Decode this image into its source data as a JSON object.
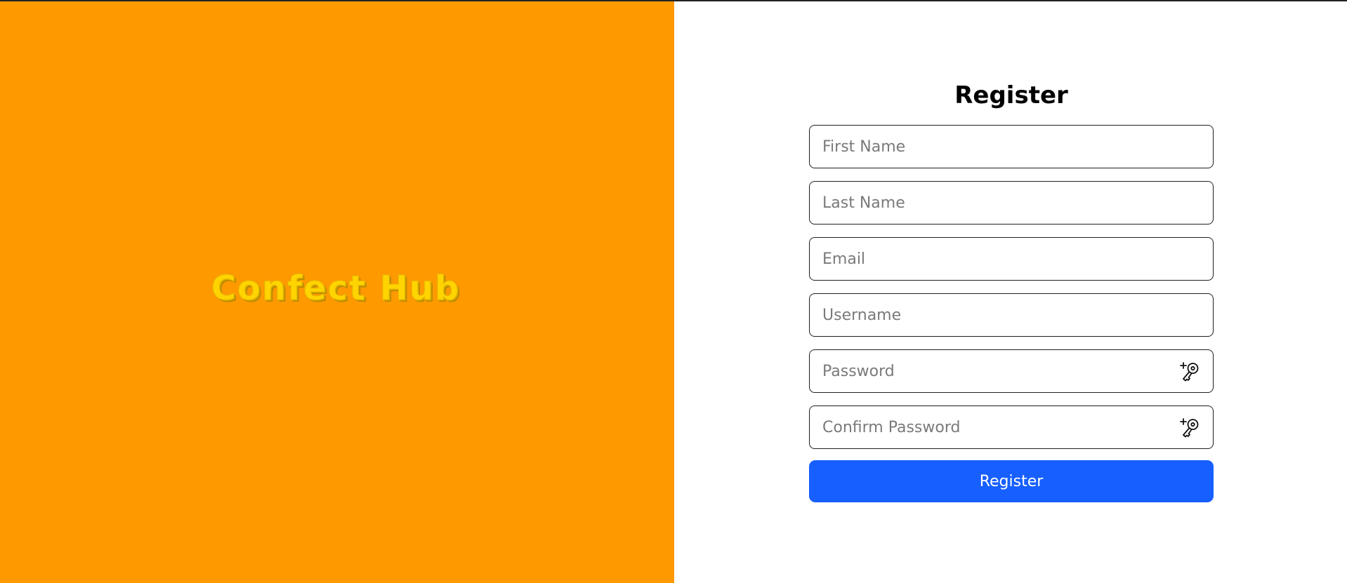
{
  "brand": {
    "logo_text": "Confect Hub",
    "panel_color": "#ff9900",
    "logo_color": "#ffd400"
  },
  "form": {
    "title": "Register",
    "fields": [
      {
        "name": "first_name",
        "placeholder": "First Name",
        "value": "",
        "type": "text"
      },
      {
        "name": "last_name",
        "placeholder": "Last Name",
        "value": "",
        "type": "text"
      },
      {
        "name": "email",
        "placeholder": "Email",
        "value": "",
        "type": "email"
      },
      {
        "name": "username",
        "placeholder": "Username",
        "value": "",
        "type": "text"
      },
      {
        "name": "password",
        "placeholder": "Password",
        "value": "",
        "type": "password",
        "icon": "key-plus-icon"
      },
      {
        "name": "confirm_password",
        "placeholder": "Confirm Password",
        "value": "",
        "type": "password",
        "icon": "key-plus-icon"
      }
    ],
    "submit_label": "Register",
    "submit_color": "#175ffe"
  }
}
